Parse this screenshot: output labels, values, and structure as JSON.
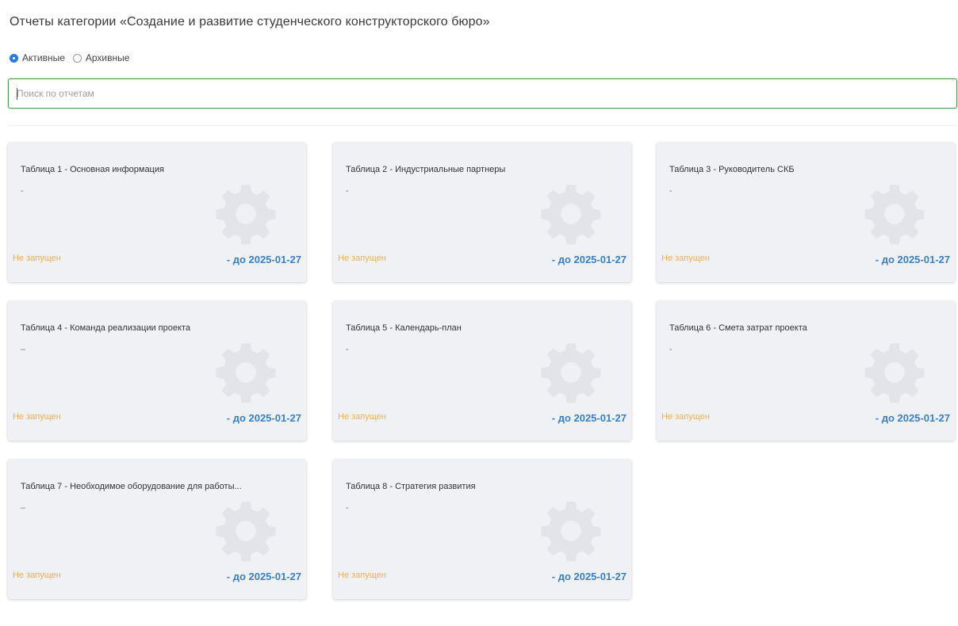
{
  "page": {
    "title": "Отчеты категории «Создание и развитие студенческого конструкторского бюро»"
  },
  "filter": {
    "active_label": "Активные",
    "archive_label": "Архивные",
    "selected": "active"
  },
  "search": {
    "placeholder": "Поиск по отчетам",
    "value": ""
  },
  "colors": {
    "accent_blue": "#3b7fc4",
    "status_orange": "#f0ad4e",
    "search_border_green": "#4a9a55"
  },
  "cards": [
    {
      "title": "Таблица 1 - Основная информация",
      "dash": "-",
      "status": "Не запущен",
      "deadline": "- до 2025-01-27",
      "icon": "gear-icon"
    },
    {
      "title": "Таблица 2 - Индустриальные партнеры",
      "dash": "-",
      "status": "Не запущен",
      "deadline": "- до 2025-01-27",
      "icon": "gear-icon"
    },
    {
      "title": "Таблица 3 - Руководитель СКБ",
      "dash": "-",
      "status": "Не запущен",
      "deadline": "- до 2025-01-27",
      "icon": "gear-icon"
    },
    {
      "title": "Таблица 4 - Команда реализации проекта",
      "dash": "–",
      "status": "Не запущен",
      "deadline": "- до 2025-01-27",
      "icon": "gear-icon"
    },
    {
      "title": "Таблица 5 - Календарь-план",
      "dash": "-",
      "status": "Не запущен",
      "deadline": "- до 2025-01-27",
      "icon": "gear-icon"
    },
    {
      "title": "Таблица 6 - Смета затрат проекта",
      "dash": "-",
      "status": "Не запущен",
      "deadline": "- до 2025-01-27",
      "icon": "gear-icon"
    },
    {
      "title": "Таблица 7 - Необходимое оборудование для работы...",
      "dash": "–",
      "status": "Не запущен",
      "deadline": "- до 2025-01-27",
      "icon": "gear-icon"
    },
    {
      "title": "Таблица 8 - Стратегия развития",
      "dash": "-",
      "status": "Не запущен",
      "deadline": "- до 2025-01-27",
      "icon": "gear-icon"
    }
  ]
}
